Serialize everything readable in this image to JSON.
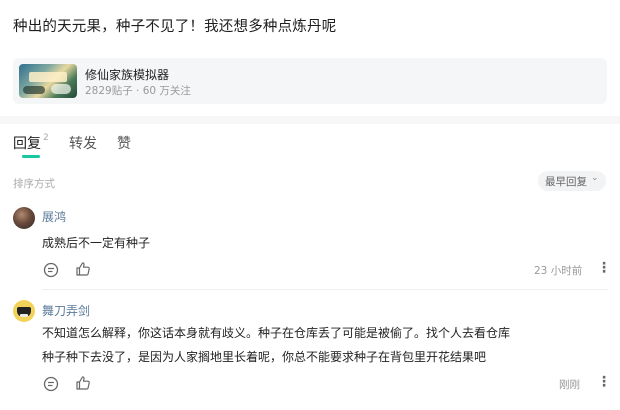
{
  "post": {
    "title": "种出的天元果，种子不见了！我还想多种点炼丹呢"
  },
  "forum": {
    "name": "修仙家族模拟器",
    "stats": "2829贴子 · 60 万关注"
  },
  "tabs": [
    {
      "label": "回复",
      "count": "2"
    },
    {
      "label": "转发"
    },
    {
      "label": "赞"
    }
  ],
  "sort": {
    "label": "排序方式",
    "selected": "最早回复"
  },
  "comments": [
    {
      "user": "展鸿",
      "text": "成熟后不一定有种子",
      "time": "23 小时前"
    },
    {
      "user": "舞刀弄剑",
      "lines": [
        "不知道怎么解释，你这话本身就有歧义。种子在仓库丢了可能是被偷了。找个人去看仓库",
        "种子种下去没了，是因为人家搁地里长着呢，你总不能要求种子在背包里开花结果吧"
      ],
      "time": "刚刚"
    }
  ],
  "colors": {
    "accent": "#18c8a0",
    "username": "#5a7a9a"
  }
}
